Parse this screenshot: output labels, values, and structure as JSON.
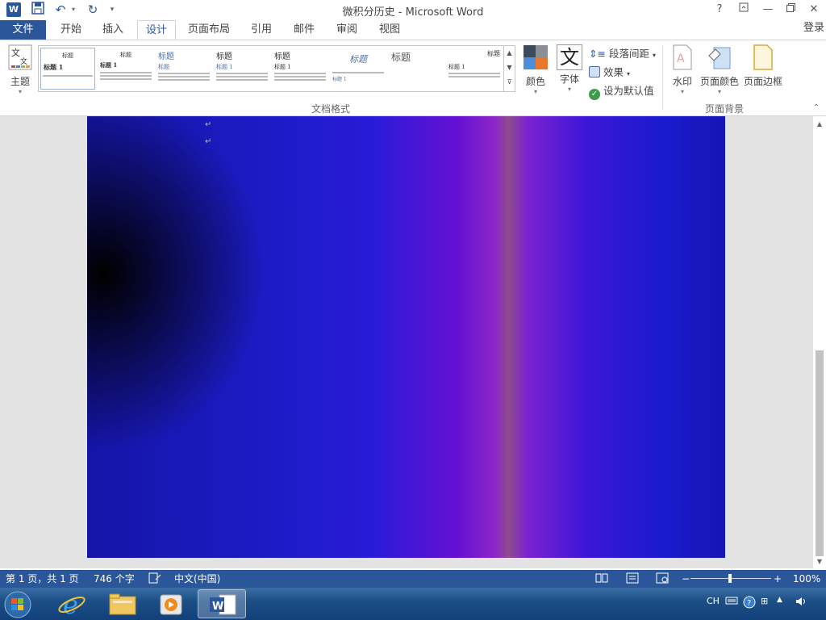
{
  "window": {
    "title": "微积分历史 - Microsoft Word",
    "app_icon_letter": "W",
    "help": "?"
  },
  "menu": {
    "file": "文件",
    "tabs": [
      "开始",
      "插入",
      "设计",
      "页面布局",
      "引用",
      "邮件",
      "审阅",
      "视图"
    ],
    "active_tab": "设计",
    "login": "登录"
  },
  "ribbon": {
    "theme_label": "主题",
    "colors_label": "颜色",
    "font_label": "字体",
    "font_glyph": "文",
    "paragraph_spacing": "段落间距",
    "effects": "效果",
    "set_default": "设为默认值",
    "watermark": "水印",
    "page_color": "页面颜色",
    "page_border": "页面边框",
    "group_doc_format": "文档格式",
    "group_page_background": "页面背景",
    "style_gallery": [
      {
        "heading": "标题",
        "subheading": "标题 1"
      },
      {
        "heading": "标题",
        "subheading": "标题 1"
      },
      {
        "heading": "标题",
        "subheading": "标题"
      },
      {
        "heading": "标题",
        "subheading": "标题 1"
      },
      {
        "heading": "标题",
        "subheading": "标题 1"
      },
      {
        "heading": "标题",
        "subheading": "标题 1"
      },
      {
        "heading": "标题",
        "subheading": ""
      },
      {
        "heading": "标题",
        "subheading": "标题 1"
      }
    ]
  },
  "document": {
    "paragraph_mark": "↵",
    "page_colors": {
      "dark": "#000000",
      "blue": "#1c1cc7",
      "purple": "#7b22d0",
      "mauve": "#8f4d8b"
    }
  },
  "status": {
    "page": "第 1 页，共 1 页",
    "words": "746 个字",
    "language": "中文(中国)",
    "zoom": "100%",
    "zoom_minus": "−",
    "zoom_plus": "+"
  },
  "taskbar": {
    "tray_lang": "CH"
  },
  "colors": {
    "accent": "#2b579a",
    "taskbar": "#1d4f86"
  }
}
